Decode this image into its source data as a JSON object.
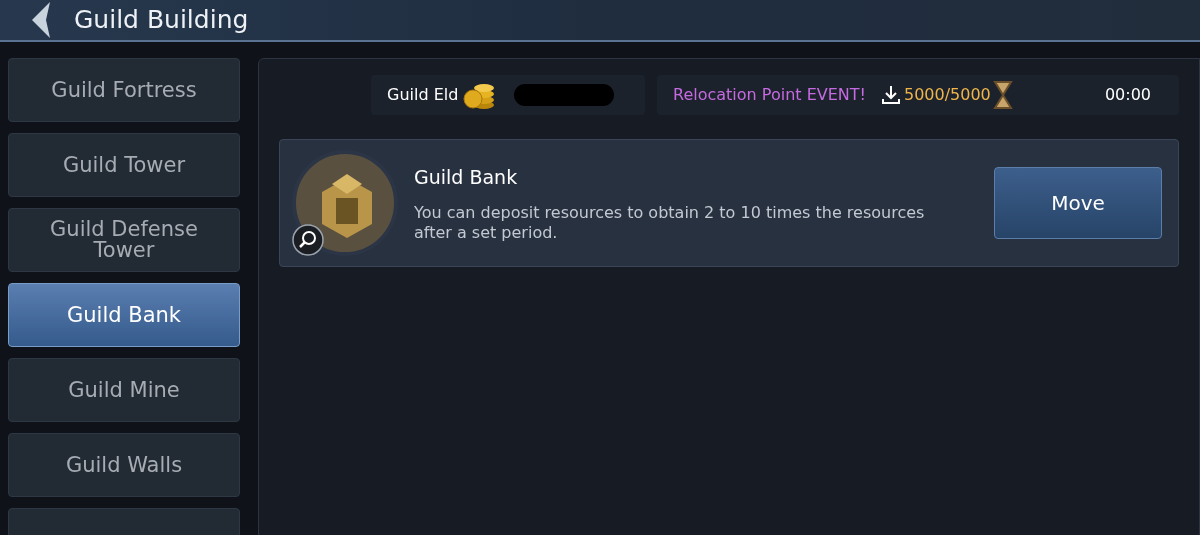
{
  "header": {
    "title": "Guild Building"
  },
  "sidebar": {
    "items": [
      {
        "label": "Guild Fortress",
        "selected": false
      },
      {
        "label": "Guild Tower",
        "selected": false
      },
      {
        "label": "Guild Defense Tower",
        "selected": false
      },
      {
        "label": "Guild Bank",
        "selected": true
      },
      {
        "label": "Guild Mine",
        "selected": false
      },
      {
        "label": "Guild Walls",
        "selected": false
      }
    ]
  },
  "resources": {
    "label": "Guild Eld"
  },
  "event": {
    "label": "Relocation Point EVENT!",
    "points": "5000/5000",
    "timer": "00:00"
  },
  "building": {
    "name": "Guild Bank",
    "description": "You can deposit resources to obtain 2 to 10 times the resources after a set period.",
    "button": "Move"
  }
}
